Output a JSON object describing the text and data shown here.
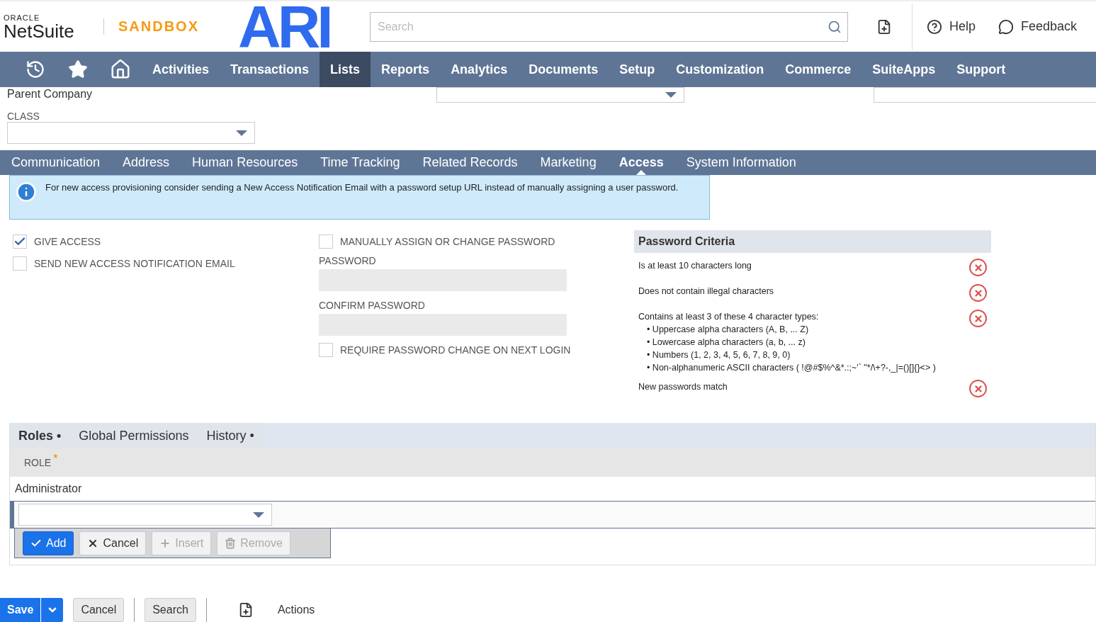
{
  "header": {
    "brand_top": "ORACLE",
    "brand": "NetSuite",
    "environment": "SANDBOX",
    "logo": "ARI",
    "search": {
      "placeholder": "Search"
    },
    "links": [
      {
        "kind": "help",
        "label": "Help"
      },
      {
        "kind": "feedback",
        "label": "Feedback"
      }
    ]
  },
  "nav": {
    "items": [
      {
        "label": "Activities",
        "selected": false
      },
      {
        "label": "Transactions",
        "selected": false
      },
      {
        "label": "Lists",
        "selected": true
      },
      {
        "label": "Reports",
        "selected": false
      },
      {
        "label": "Analytics",
        "selected": false
      },
      {
        "label": "Documents",
        "selected": false
      },
      {
        "label": "Setup",
        "selected": false
      },
      {
        "label": "Customization",
        "selected": false
      },
      {
        "label": "Commerce",
        "selected": false
      },
      {
        "label": "SuiteApps",
        "selected": false
      },
      {
        "label": "Support",
        "selected": false
      }
    ]
  },
  "top_fields": {
    "parent_label": "Parent Company",
    "class_label": "CLASS"
  },
  "subtabs": [
    {
      "label": "Communication",
      "selected": false
    },
    {
      "label": "Address",
      "selected": false
    },
    {
      "label": "Human Resources",
      "selected": false
    },
    {
      "label": "Time Tracking",
      "selected": false
    },
    {
      "label": "Related Records",
      "selected": false
    },
    {
      "label": "Marketing",
      "selected": false
    },
    {
      "label": "Access",
      "selected": true
    },
    {
      "label": "System Information",
      "selected": false
    }
  ],
  "info": "For new access provisioning consider sending a New Access Notification Email with a password setup URL instead of manually assigning a user password.",
  "left_checks": [
    {
      "label": "GIVE ACCESS",
      "checked": true
    },
    {
      "label": "SEND NEW ACCESS NOTIFICATION EMAIL",
      "checked": false
    }
  ],
  "manual": {
    "label": "MANUALLY ASSIGN OR CHANGE PASSWORD",
    "checked": false
  },
  "password_label": "PASSWORD",
  "confirm_label": "CONFIRM PASSWORD",
  "require": {
    "label": "REQUIRE PASSWORD CHANGE ON NEXT LOGIN",
    "checked": false
  },
  "criteria": {
    "title": "Password Criteria",
    "items": [
      {
        "text": "Is at least 10 characters long",
        "met": false
      },
      {
        "text": "Does not contain illegal characters",
        "met": false
      },
      {
        "text": "Contains at least 3 of these 4 character types:",
        "met": false,
        "bullets": [
          "• Uppercase alpha characters (A, B, ... Z)",
          "• Lowercase alpha characters (a, b, ... z)",
          "• Numbers (1, 2, 3, 4, 5, 6, 7, 8, 9, 0)",
          "• Non-alphanumeric ASCII characters ( !@#$%^&*.:;~'` \"*/\\+?-,_|=()[]{}<> )"
        ]
      },
      {
        "text": "New passwords match",
        "met": false
      }
    ]
  },
  "lower_tabs": [
    {
      "label": "Roles",
      "dot": "•",
      "selected": true
    },
    {
      "label": "Global Permissions",
      "selected": false
    },
    {
      "label": "History",
      "dot": "•",
      "selected": false
    }
  ],
  "roles": {
    "column": "ROLE",
    "required": "*",
    "rows": [
      "Administrator"
    ],
    "buttons": [
      {
        "kind": "add",
        "label": "Add",
        "disabled": false
      },
      {
        "kind": "cancel",
        "label": "Cancel",
        "disabled": false
      },
      {
        "kind": "insert",
        "label": "Insert",
        "disabled": true
      },
      {
        "kind": "remove",
        "label": "Remove",
        "disabled": true
      }
    ]
  },
  "footer": {
    "save": "Save",
    "cancel": "Cancel",
    "search": "Search",
    "actions": "Actions"
  }
}
